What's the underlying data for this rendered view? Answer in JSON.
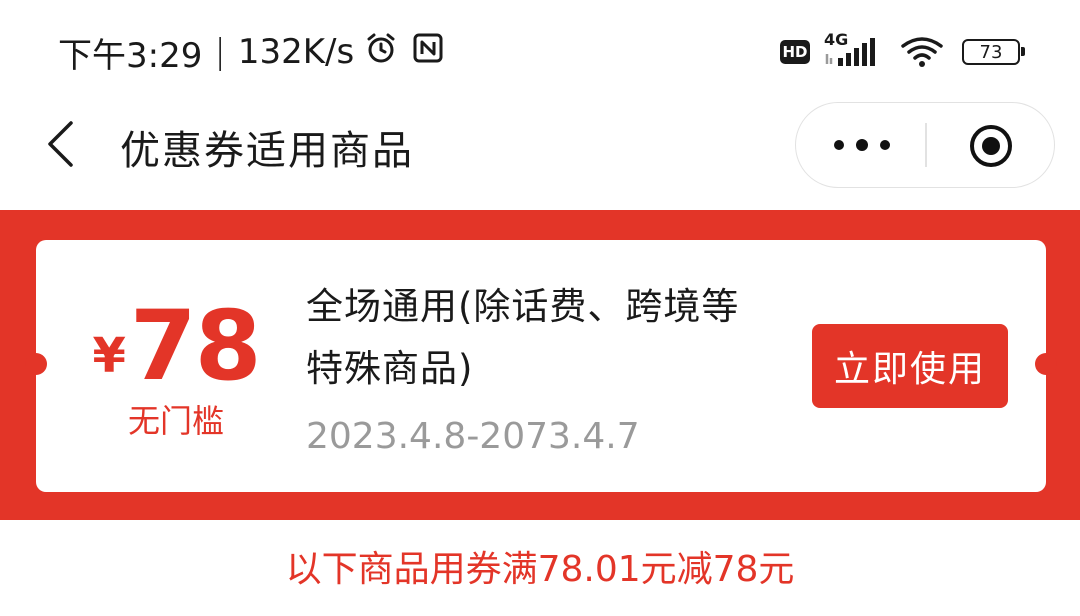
{
  "status_bar": {
    "time": "下午3:29",
    "separator": "|",
    "net_speed": "132K/s",
    "hd_label": "HD",
    "network_type": "4G",
    "battery_level": "73",
    "icons": [
      "alarm-icon",
      "nfc-icon",
      "hd-icon",
      "signal-icon",
      "wifi-icon",
      "battery-icon"
    ]
  },
  "header": {
    "title": "优惠券适用商品",
    "icons": [
      "back-icon",
      "more-icon",
      "close-target-icon"
    ]
  },
  "coupon": {
    "currency": "¥",
    "amount": "78",
    "threshold": "无门槛",
    "description": "全场通用(除话费、跨境等特殊商品)",
    "validity": "2023.4.8-2073.4.7",
    "action_label": "立即使用"
  },
  "rule_text": "以下商品用券满78.01元减78元",
  "colors": {
    "primary_red": "#e33528",
    "text_dark": "#1a1a1a",
    "text_gray": "#9a9a9a",
    "border": "#e2e2e2"
  }
}
